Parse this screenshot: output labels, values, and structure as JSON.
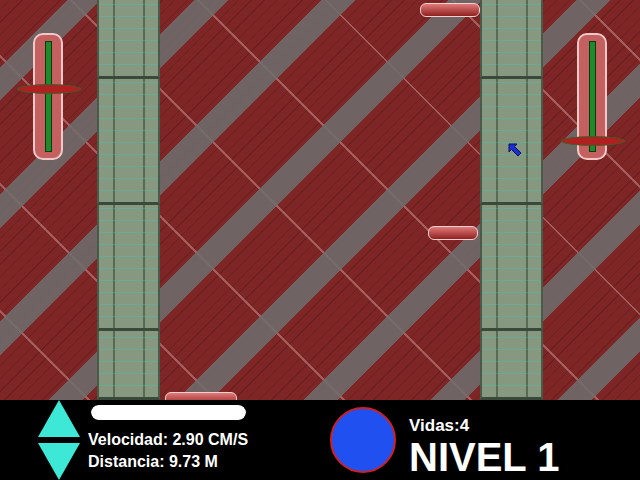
{
  "game": {
    "sliders": [
      {
        "side": "left",
        "level": 0.57
      },
      {
        "side": "right",
        "level": 0.15
      }
    ]
  },
  "hud": {
    "progress": {
      "level": 1
    },
    "speed": "Velocidad: 2.90 CM/S",
    "distance": "Distancia: 9.73 M",
    "lives": "Vidas:4",
    "level_label": "NIVEL 1"
  }
}
